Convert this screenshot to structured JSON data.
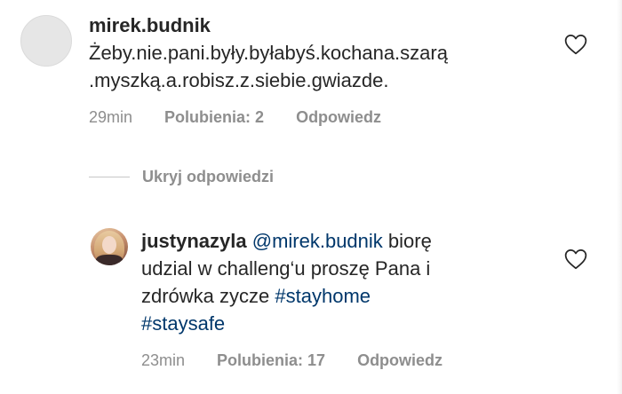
{
  "comments": [
    {
      "username": "mirek.budnik",
      "text_line1": "Żeby.nie.pani.były.byłabyś.kochana.szarą",
      "text_line2": ".myszką.a.robisz.z.siebie.gwiazde.",
      "time": "29min",
      "likes": "Polubienia: 2",
      "reply_label": "Odpowiedz",
      "avatar_icon": "default-avatar-icon",
      "like_icon": "heart-outline-icon"
    },
    {
      "username": "justynazyla",
      "mention": "@mirek.budnik",
      "text_part1": " biorę",
      "text_line2": "udzial w challeng‘u proszę Pana i",
      "text_line3_plain": "zdrówka zycze ",
      "hashtag1": "#stayhome",
      "hashtag2": "#staysafe",
      "time": "23min",
      "likes": "Polubienia: 17",
      "reply_label": "Odpowiedz",
      "avatar_icon": "profile-photo",
      "like_icon": "heart-outline-icon"
    }
  ],
  "replies_toggle": {
    "label": "Ukryj odpowiedzi"
  },
  "colors": {
    "text": "#262626",
    "secondary": "#8e8e8e",
    "link": "#00376b",
    "divider": "#c7c7c7"
  }
}
